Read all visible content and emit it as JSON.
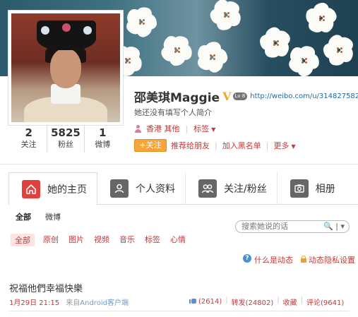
{
  "profile": {
    "name": "邵美琪Maggie",
    "verified_badge": "V",
    "level_badge": "Lv 8",
    "url": "http://weibo.com/u/3148275822",
    "intro": "她还没有填写个人简介",
    "location": "香港 其他",
    "tags_label": "标签",
    "follow_label": "+关注",
    "recommend_label": "推荐给朋友",
    "blacklist_label": "加入黑名单",
    "more_label": "更多"
  },
  "stats": [
    {
      "num": "2",
      "label": "关注"
    },
    {
      "num": "5825",
      "label": "粉丝"
    },
    {
      "num": "1",
      "label": "微博"
    }
  ],
  "tabs": [
    {
      "label": "她的主页",
      "icon": "home-icon"
    },
    {
      "label": "个人资料",
      "icon": "profile-icon"
    },
    {
      "label": "关注/粉丝",
      "icon": "followers-icon"
    },
    {
      "label": "相册",
      "icon": "camera-icon"
    }
  ],
  "subnav": [
    "全部",
    "微博"
  ],
  "search": {
    "placeholder": "搜索她说的话"
  },
  "filters": [
    "全部",
    "原创",
    "图片",
    "视频",
    "音乐",
    "标签",
    "心情"
  ],
  "helper": {
    "what_label": "什么是动态",
    "privacy_label": "动态隐私设置"
  },
  "post": {
    "text": "祝福他們幸福快樂",
    "time": "1月29日 21:15",
    "source_prefix": "来自",
    "source": "Android客户端",
    "likes": "(2614)",
    "repost": "转发(24802)",
    "favorite": "收藏",
    "comment": "评论(9641)"
  },
  "colors": {
    "accent": "#c23a3a",
    "follow": "#f7a53a",
    "active_tab_icon": "#e2403d"
  }
}
